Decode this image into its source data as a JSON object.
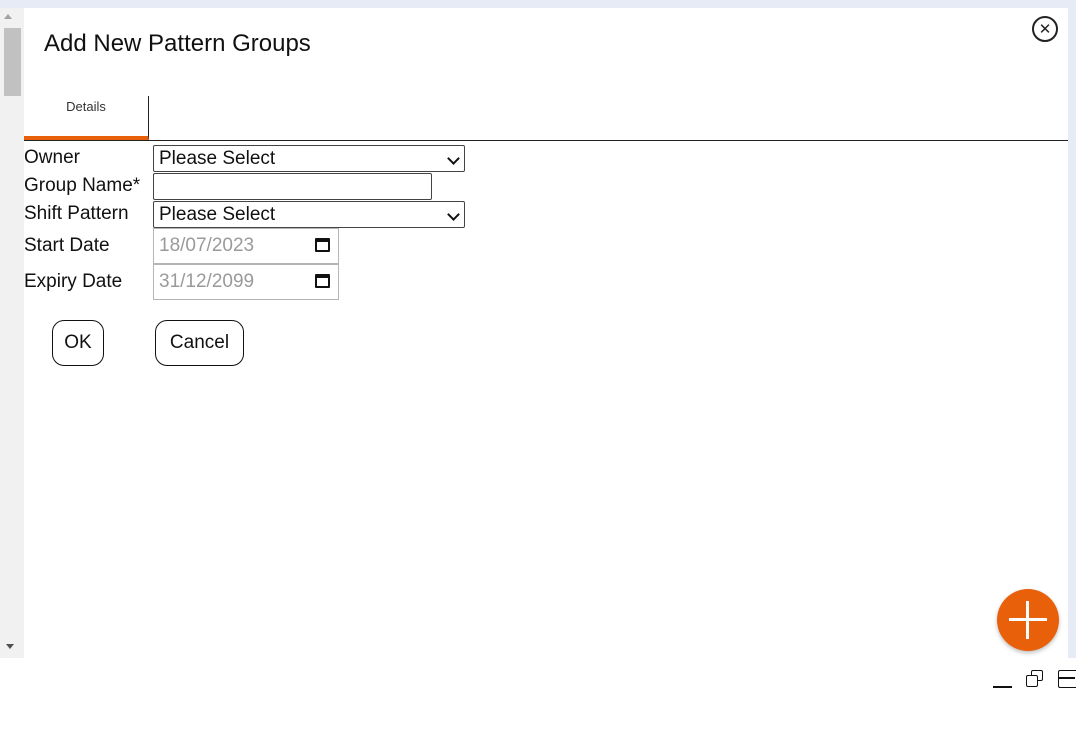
{
  "dialog": {
    "title": "Add New Pattern Groups",
    "close_icon": "close-icon"
  },
  "tabs": [
    {
      "label": "Details",
      "active": true
    }
  ],
  "accent_color": "#e8600a",
  "form": {
    "owner": {
      "label": "Owner",
      "value": "Please Select"
    },
    "group_name": {
      "label": "Group Name*",
      "value": ""
    },
    "shift_pattern": {
      "label": "Shift Pattern",
      "value": "Please Select"
    },
    "start_date": {
      "label": "Start Date",
      "value": "18/07/2023"
    },
    "expiry_date": {
      "label": "Expiry Date",
      "value": "31/12/2099"
    }
  },
  "buttons": {
    "ok": "OK",
    "cancel": "Cancel"
  },
  "fab": {
    "icon": "plus-icon"
  },
  "window_controls": [
    "minimize-icon",
    "restore-icon",
    "maximize-icon"
  ]
}
